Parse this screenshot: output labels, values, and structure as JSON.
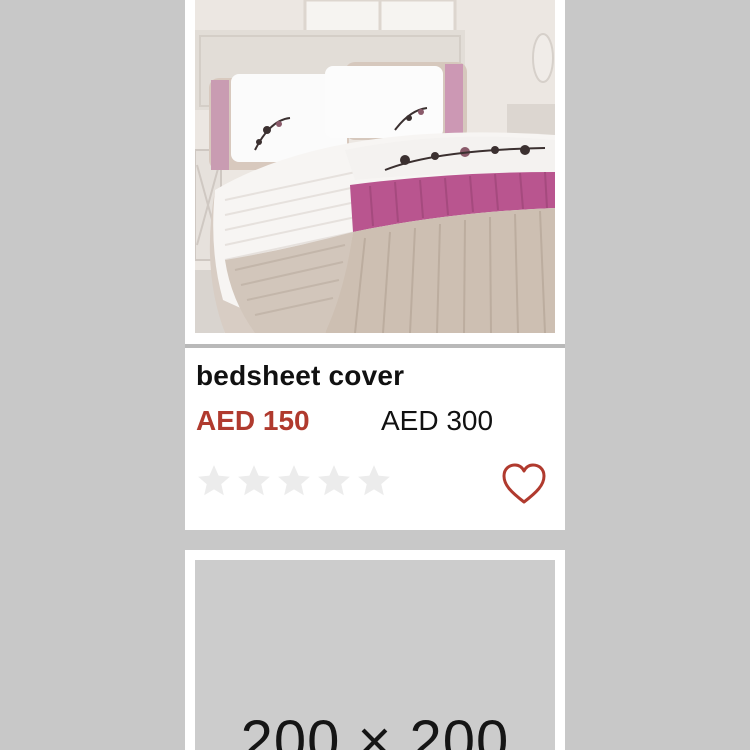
{
  "products": [
    {
      "image_alt": "bedsheet cover photo",
      "title": "bedsheet cover",
      "sale_price": "AED 150",
      "original_price": "AED 300",
      "rating": 0,
      "rating_max": 5,
      "wishlist_icon": "heart-outline-icon"
    },
    {
      "placeholder_text": "200 × 200"
    }
  ],
  "colors": {
    "background": "#c8c8c8",
    "card": "#ffffff",
    "sale_price": "#b03a2e",
    "wishlist_heart": "#b03a2e",
    "star_empty": "#ececec"
  }
}
